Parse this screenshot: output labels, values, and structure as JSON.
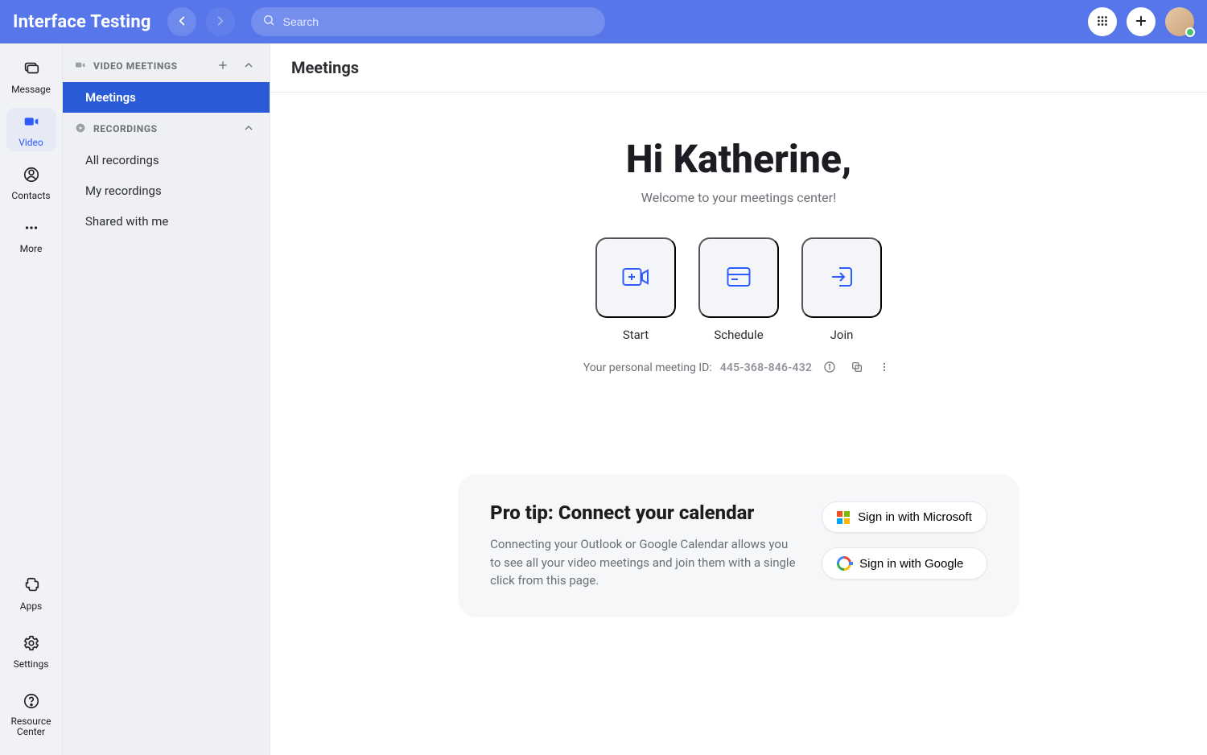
{
  "header": {
    "app_title": "Interface Testing",
    "search_placeholder": "Search"
  },
  "rail": {
    "items": [
      {
        "label": "Message"
      },
      {
        "label": "Video"
      },
      {
        "label": "Contacts"
      },
      {
        "label": "More"
      }
    ],
    "bottom": [
      {
        "label": "Apps"
      },
      {
        "label": "Settings"
      },
      {
        "label": "Resource Center"
      }
    ]
  },
  "sidebar": {
    "sections": [
      {
        "title": "VIDEO MEETINGS",
        "items": [
          {
            "label": "Meetings"
          }
        ]
      },
      {
        "title": "RECORDINGS",
        "items": [
          {
            "label": "All recordings"
          },
          {
            "label": "My recordings"
          },
          {
            "label": "Shared with me"
          }
        ]
      }
    ]
  },
  "main": {
    "page_title": "Meetings",
    "greeting": "Hi Katherine,",
    "subtitle": "Welcome to your meetings center!",
    "actions": [
      {
        "label": "Start"
      },
      {
        "label": "Schedule"
      },
      {
        "label": "Join"
      }
    ],
    "pmi_label": "Your personal meeting ID:",
    "pmi_value": "445-368-846-432",
    "tip": {
      "title": "Pro tip: Connect your calendar",
      "body": "Connecting your Outlook or Google Calendar allows you to see all your video meetings and join them with a single click from this page.",
      "microsoft": "Sign in with Microsoft",
      "google": "Sign in with Google"
    }
  }
}
